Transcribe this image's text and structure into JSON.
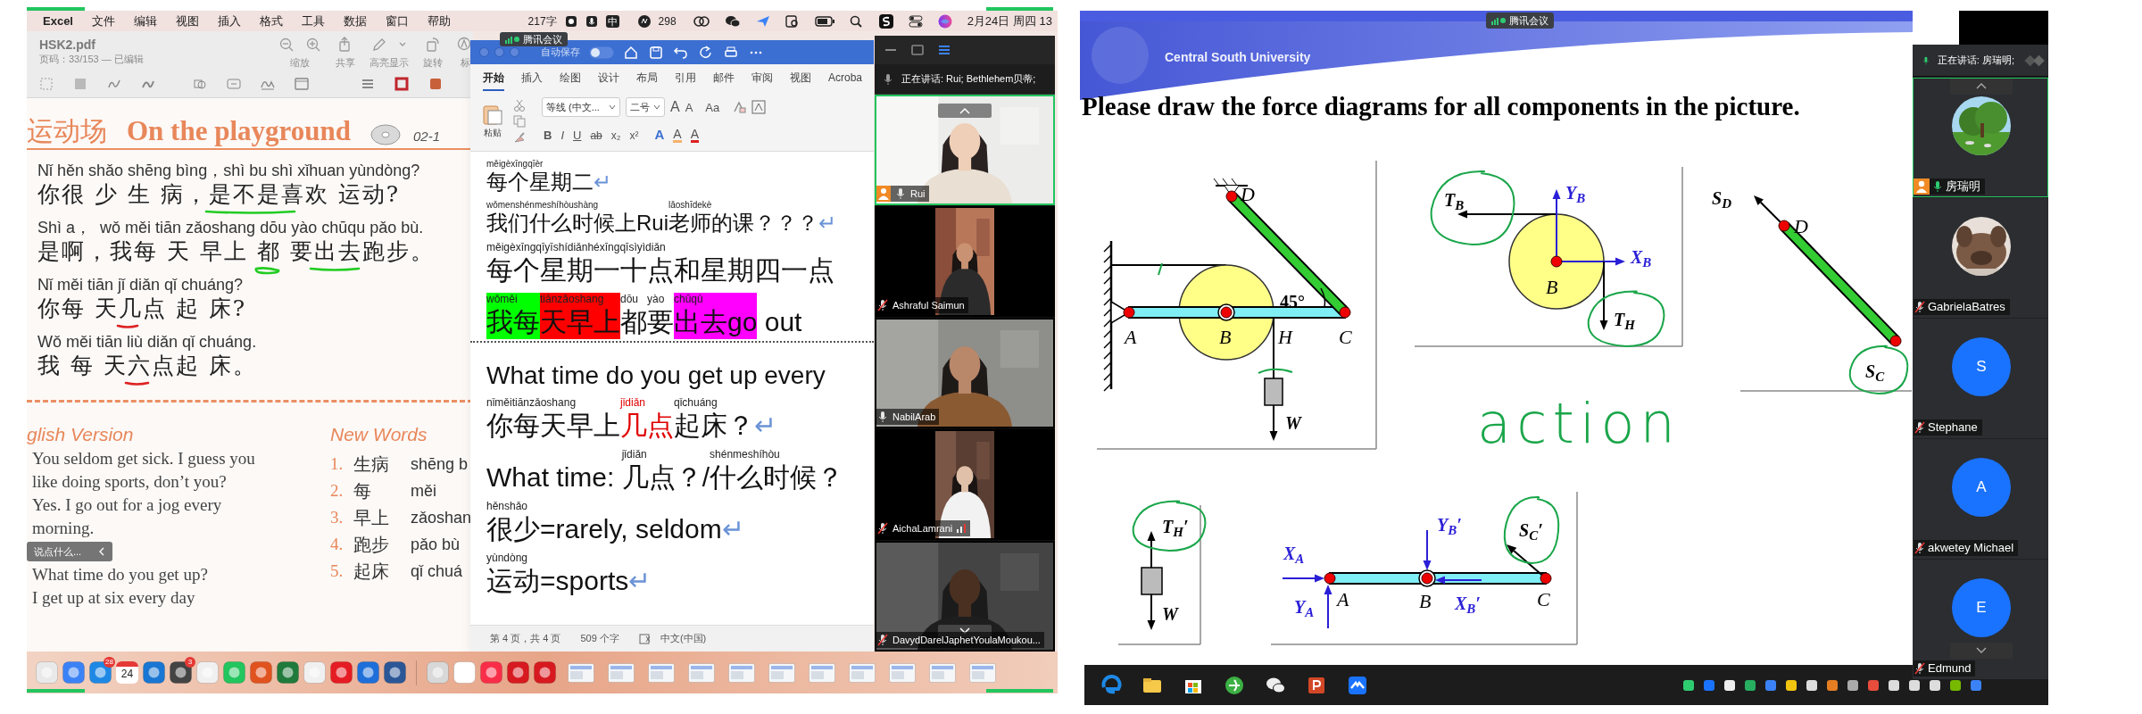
{
  "left_screen": {
    "menu_bar": {
      "app": "Excel",
      "items": [
        "文件",
        "编辑",
        "视图",
        "插入",
        "格式",
        "工具",
        "数据",
        "窗口",
        "帮助"
      ],
      "word_count": "217字",
      "input_method": "中",
      "badge_count": "298",
      "clock": "2月24日 周四 13"
    },
    "pdf_window": {
      "title": "HSK2.pdf",
      "subtitle": "页码：33/153 — 已编辑",
      "tools": [
        "缩放",
        "共享",
        "高亮显示",
        "旋转",
        "标"
      ],
      "page": {
        "heading_cn": "运动场",
        "heading_en": "On the playground",
        "track": "02-1",
        "dialogue": [
          {
            "pinyin": "Nǐ hěn shǎo shēng bìng，shì bu shì xǐhuan yùndòng?",
            "hanzi": "你很 少 生 病，是不是喜欢 运动?"
          },
          {
            "pinyin": "Shì a，  wǒ měi tiān zǎoshang dōu yào chūqu pǎo bù.",
            "hanzi": "是啊，我每 天 早上 都 要出去跑步。"
          },
          {
            "pinyin": "Nǐ měi tiān jǐ diǎn qǐ chuáng?",
            "hanzi": "你每 天几点 起 床?"
          },
          {
            "pinyin": "Wǒ měi tiān liù diǎn qǐ chuáng.",
            "hanzi": "我 每 天六点起 床。"
          }
        ],
        "english_heading": "glish Version",
        "english": [
          "You seldom get sick. I guess you",
          "like doing sports, don’t you?",
          "Yes. I go out for a jog every",
          "morning.",
          "What time do you get up?",
          "I get up at six every day"
        ],
        "words_heading": "New Words",
        "words": [
          {
            "number": "1.",
            "hanzi": "生病",
            "pinyin": "shēng b"
          },
          {
            "number": "2.",
            "hanzi": "每",
            "pinyin": "měi"
          },
          {
            "number": "3.",
            "hanzi": "早上",
            "pinyin": "zǎoshan"
          },
          {
            "number": "4.",
            "hanzi": "跑步",
            "pinyin": "pǎo bù"
          },
          {
            "number": "5.",
            "hanzi": "起床",
            "pinyin": "qǐ chuá"
          }
        ]
      },
      "chat_hint": "说点什么..."
    },
    "meeting_badge": "腾讯会议",
    "word_window": {
      "autosave": "自动保存",
      "autosave_on": false,
      "tabs": [
        {
          "label": "开始",
          "selected": true
        },
        {
          "label": "插入",
          "selected": false
        },
        {
          "label": "绘图",
          "selected": false
        },
        {
          "label": "设计",
          "selected": false
        },
        {
          "label": "布局",
          "selected": false
        },
        {
          "label": "引用",
          "selected": false
        },
        {
          "label": "邮件",
          "selected": false
        },
        {
          "label": "审阅",
          "selected": false
        },
        {
          "label": "视图",
          "selected": false
        },
        {
          "label": "Acroba",
          "selected": false
        }
      ],
      "paste": "粘贴",
      "font": "等线 (中文...",
      "size": "二号",
      "size_buttons": [
        "A",
        "A",
        "Aa"
      ],
      "format_buttons": [
        "B",
        "I",
        "U",
        "ab",
        "x₂",
        "x²"
      ],
      "color_buttons": [
        "A",
        "A",
        "A"
      ],
      "lines": [
        {
          "kind": "small",
          "segments": [
            {
              "pinyin": "měigèxīngqīèr",
              "text": "每个星期二"
            },
            {
              "text": "↵",
              "mark": true
            }
          ]
        },
        {
          "kind": "small",
          "segments": [
            {
              "pinyin": "wǒmenshénmeshíhòushàng",
              "text": "我们什么时候上"
            },
            {
              "text": "Rui"
            },
            {
              "pinyin": "lǎoshīdekè",
              "text": "老师的课"
            },
            {
              "text": "？？？"
            },
            {
              "text": "↵",
              "mark": true
            }
          ]
        },
        {
          "kind": "large",
          "segments": [
            {
              "pinyin": "měigèxīngqīyīshídiǎnhéxīngqīsìyìdiǎn",
              "text": "每个星期一十点和星期四一点"
            }
          ]
        },
        {
          "kind": "large",
          "segments": [
            {
              "pinyin": "wǒměi",
              "text": "我每",
              "kind": "highlight",
              "color": "#00ff00"
            },
            {
              "pinyin": "tiānzǎoshang",
              "text": "天早上",
              "kind": "highlight",
              "color": "#ff0000"
            },
            {
              "pinyin": "dōu",
              "text": "都"
            },
            {
              "pinyin": "yào",
              "text": "要"
            },
            {
              "pinyin": "chūqù",
              "text": "出去go",
              "kind": "highlight",
              "color": "#ff00ff"
            },
            {
              "text": " out"
            }
          ]
        },
        {
          "kind": "separator"
        },
        {
          "kind": "plain",
          "segments": [
            {
              "text": "What time do you get up every"
            }
          ]
        },
        {
          "kind": "large",
          "segments": [
            {
              "pinyin": "nǐměitiānzǎoshang",
              "text": "你每天早上"
            },
            {
              "pinyin": "jǐdiǎn",
              "text": "几点",
              "kind": "colored",
              "color": "#e00000"
            },
            {
              "pinyin": "qǐchuáng",
              "text": "起床"
            },
            {
              "text": "？"
            },
            {
              "text": "↵",
              "mark": true
            }
          ]
        },
        {
          "kind": "large",
          "segments": [
            {
              "text": "What time: "
            },
            {
              "pinyin": "jǐdiǎn",
              "text": "几点"
            },
            {
              "text": "？/"
            },
            {
              "pinyin": "shénmeshíhòu",
              "text": "什么时候"
            },
            {
              "text": "？"
            }
          ]
        },
        {
          "kind": "large",
          "segments": [
            {
              "pinyin": "hěnshǎo",
              "text": "很少"
            },
            {
              "text": "=rarely, seldom"
            },
            {
              "text": "↵",
              "mark": true
            }
          ]
        },
        {
          "kind": "large",
          "segments": [
            {
              "pinyin": "yùndòng",
              "text": "运动"
            },
            {
              "text": "=sports"
            },
            {
              "text": "↵",
              "mark": true
            }
          ]
        }
      ],
      "status": [
        "第 4 页，共 4 页",
        "509 个字",
        "中文(中国)"
      ]
    },
    "video_panel": {
      "speaking": "正在讲话: Rui; Bethlehem贝蒂;",
      "tiles": [
        {
          "name": "Rui",
          "muted": false,
          "host": true,
          "selected": true,
          "kind": "wide",
          "weak_signal": false
        },
        {
          "name": "Ashraful Saimun",
          "muted": true,
          "host": false,
          "selected": false,
          "kind": "narrow",
          "weak_signal": false
        },
        {
          "name": "NabilArab",
          "muted": false,
          "host": false,
          "selected": false,
          "kind": "wide",
          "weak_signal": false
        },
        {
          "name": "AichaLamrani",
          "muted": true,
          "host": false,
          "selected": false,
          "kind": "narrow",
          "weak_signal": true
        },
        {
          "name": "DavydDarelJaphetYoulaMoukou...",
          "muted": true,
          "host": false,
          "selected": false,
          "kind": "wide",
          "weak_signal": false
        }
      ]
    },
    "dock": {
      "calendar_day": "24",
      "badges": [
        "28",
        "3"
      ]
    }
  },
  "right_screen": {
    "meeting_badge": "腾讯会议",
    "slide": {
      "banner": "Central South University",
      "title": "Please draw the force diagrams for all components in the picture.",
      "diagrams": [
        {
          "labels": [
            {
              "text": "D",
              "kind": "point",
              "color": "#000000"
            },
            {
              "text": "A",
              "kind": "point",
              "color": "#000000"
            },
            {
              "text": "B",
              "kind": "point",
              "color": "#000000"
            },
            {
              "text": "H",
              "kind": "point",
              "color": "#000000"
            },
            {
              "text": "C",
              "kind": "point",
              "color": "#000000"
            },
            {
              "text": "45°",
              "kind": "angle",
              "color": "#000000"
            },
            {
              "text": "W",
              "kind": "force",
              "color": "#000000"
            }
          ]
        },
        {
          "labels": [
            {
              "text": "T$_{B}$",
              "kind": "force",
              "color": "#000000"
            },
            {
              "text": "Y$_{B}$",
              "kind": "force",
              "color": "#2a1fd6"
            },
            {
              "text": "X$_{B}$",
              "kind": "force",
              "color": "#2a1fd6"
            },
            {
              "text": "B",
              "kind": "point",
              "color": "#000000"
            },
            {
              "text": "T$_{H}$",
              "kind": "force",
              "color": "#000000"
            }
          ]
        },
        {
          "labels": [
            {
              "text": "S$_{D}$",
              "kind": "force",
              "color": "#000000"
            },
            {
              "text": "D",
              "kind": "point",
              "color": "#000000"
            },
            {
              "text": "S$_{C}$",
              "kind": "force",
              "color": "#000000"
            }
          ]
        },
        {
          "labels": [
            {
              "text": "T$_{H}$′",
              "kind": "force",
              "color": "#000000"
            },
            {
              "text": "W",
              "kind": "force",
              "color": "#000000"
            }
          ]
        },
        {
          "labels": [
            {
              "text": "X$_{A}$",
              "kind": "force",
              "color": "#2a1fd6"
            },
            {
              "text": "Y$_{A}$",
              "kind": "force",
              "color": "#2a1fd6"
            },
            {
              "text": "A",
              "kind": "point",
              "color": "#000000"
            },
            {
              "text": "B",
              "kind": "point",
              "color": "#000000"
            },
            {
              "text": "X$_{B}$′",
              "kind": "force",
              "color": "#2a1fd6"
            },
            {
              "text": "C",
              "kind": "point",
              "color": "#000000"
            },
            {
              "text": "Y$_{B}$′",
              "kind": "force",
              "color": "#2a1fd6"
            },
            {
              "text": "S$_{C}$′",
              "kind": "force",
              "color": "#000000"
            }
          ]
        }
      ],
      "handwriting": "action"
    },
    "participants": {
      "speaking": "正在讲话: 房瑞明;",
      "tiles": [
        {
          "name": "房瑞明",
          "muted": false,
          "host": true,
          "selected": true,
          "kind": "picture"
        },
        {
          "name": "GabrielaBatres",
          "muted": true,
          "host": false,
          "selected": false,
          "kind": "picture"
        },
        {
          "name": "Stephane",
          "muted": true,
          "host": false,
          "selected": false,
          "kind": "initial",
          "initial": "S"
        },
        {
          "name": "akwetey Michael",
          "muted": true,
          "host": false,
          "selected": false,
          "kind": "initial",
          "initial": "A"
        },
        {
          "name": "Edmund",
          "muted": true,
          "host": false,
          "selected": false,
          "kind": "initial",
          "initial": "E"
        }
      ]
    }
  }
}
